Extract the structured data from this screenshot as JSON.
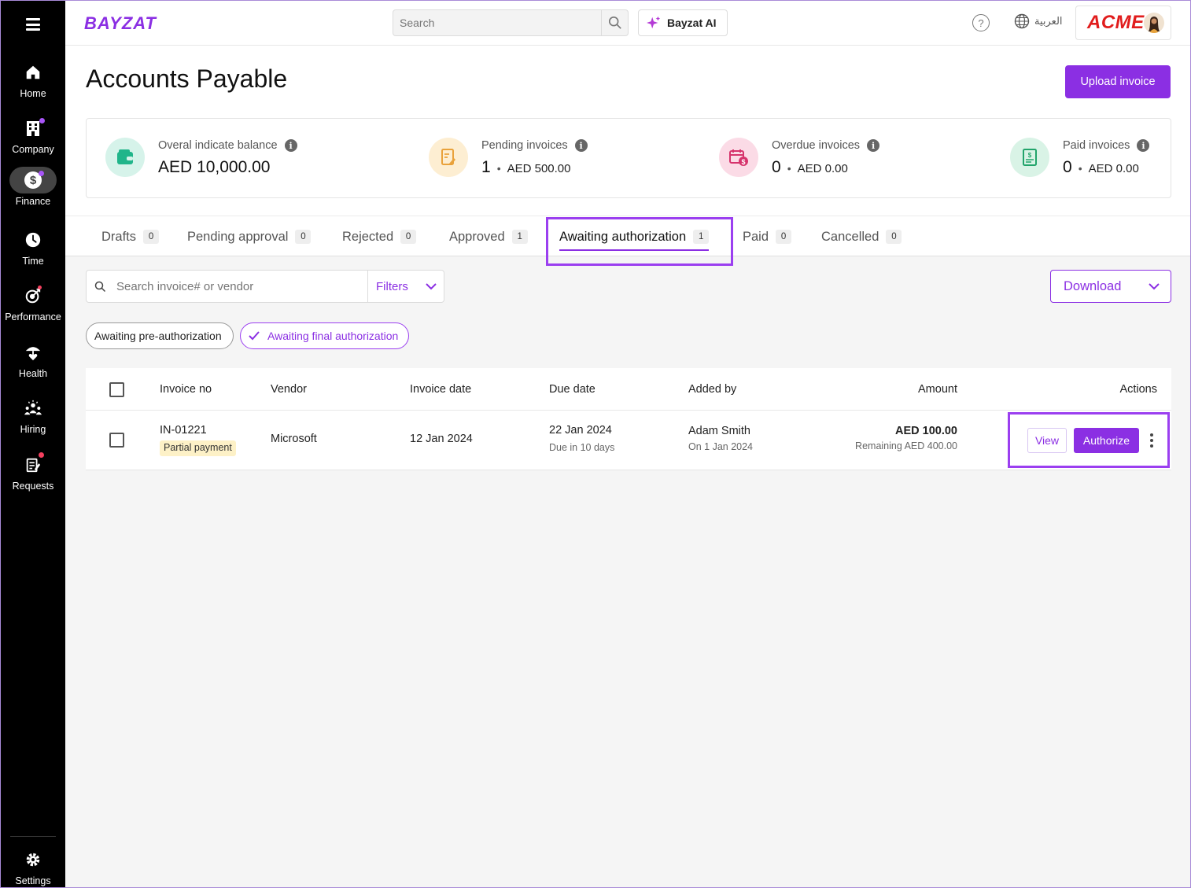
{
  "sidebar": {
    "items": [
      {
        "label": "Home",
        "icon": "home-icon"
      },
      {
        "label": "Company",
        "icon": "building-icon"
      },
      {
        "label": "Finance",
        "icon": "dollar-icon"
      },
      {
        "label": "Time",
        "icon": "clock-icon"
      },
      {
        "label": "Performance",
        "icon": "target-icon"
      },
      {
        "label": "Health",
        "icon": "umbrella-heart-icon"
      },
      {
        "label": "Hiring",
        "icon": "people-icon"
      },
      {
        "label": "Requests",
        "icon": "request-form-icon"
      }
    ],
    "settings_label": "Settings",
    "active": "Finance"
  },
  "topbar": {
    "logo": "BAYZAT",
    "search_placeholder": "Search",
    "ai_label": "Bayzat AI",
    "help_symbol": "?",
    "language": "العربية",
    "company_logo": "ACME"
  },
  "page": {
    "title": "Accounts Payable",
    "upload_label": "Upload invoice"
  },
  "stats": {
    "balance": {
      "label": "Overal indicate balance",
      "value": "AED 10,000.00"
    },
    "pending": {
      "label": "Pending invoices",
      "count": "1",
      "amount": "AED 500.00"
    },
    "overdue": {
      "label": "Overdue invoices",
      "count": "0",
      "amount": "AED 0.00"
    },
    "paid": {
      "label": "Paid invoices",
      "count": "0",
      "amount": "AED 0.00"
    },
    "info_symbol": "i",
    "separator": "•"
  },
  "tabs": [
    {
      "label": "Drafts",
      "count": "0"
    },
    {
      "label": "Pending approval",
      "count": "0"
    },
    {
      "label": "Rejected",
      "count": "0"
    },
    {
      "label": "Approved",
      "count": "1"
    },
    {
      "label": "Awaiting authorization",
      "count": "1"
    },
    {
      "label": "Paid",
      "count": "0"
    },
    {
      "label": "Cancelled",
      "count": "0"
    }
  ],
  "active_tab": "Awaiting authorization",
  "filters": {
    "search_placeholder": "Search invoice# or vendor",
    "filters_label": "Filters",
    "download_label": "Download",
    "chips": [
      "Awaiting pre-authorization",
      "Awaiting final authorization"
    ],
    "selected_chip": "Awaiting final authorization"
  },
  "table": {
    "columns": [
      "Invoice no",
      "Vendor",
      "Invoice date",
      "Due date",
      "Added by",
      "Amount",
      "Actions"
    ],
    "rows": [
      {
        "invoice_no": "IN-01221",
        "payment_badge": "Partial payment",
        "vendor": "Microsoft",
        "invoice_date": "12 Jan 2024",
        "due_date": "22 Jan 2024",
        "due_note": "Due in 10 days",
        "added_by": "Adam Smith",
        "added_on": "On 1 Jan 2024",
        "amount": "AED 100.00",
        "remaining": "Remaining AED 400.00",
        "view_label": "View",
        "authorize_label": "Authorize"
      }
    ]
  },
  "colors": {
    "accent": "#8b2fe3",
    "sidebar_bg": "#000000",
    "highlight": "#9b3ff0"
  }
}
